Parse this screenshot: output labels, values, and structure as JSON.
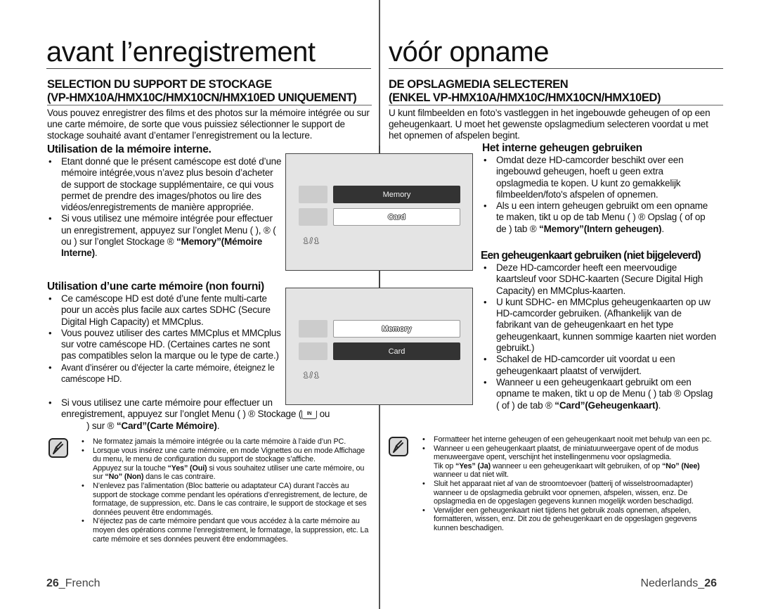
{
  "left": {
    "page_title": "avant l’enregistrement",
    "section_heading_line1": "SELECTION DU SUPPORT DE STOCKAGE",
    "section_heading_line2": "(VP-HMX10A/HMX10C/HMX10CN/HMX10ED UNIQUEMENT)",
    "intro": "Vous pouvez enregistrer des films et des photos sur la mémoire intégrée ou sur une carte mémoire, de sorte que vous puissiez sélectionner le support de stockage souhaité avant d’entamer l’enregistrement ou la lecture.",
    "sub1_heading": "Utilisation de la mémoire interne.",
    "sub1_items": [
      "Etant donné que le présent caméscope est doté d’une mémoire intégrée,vous n’avez plus besoin d’acheter de support de stockage supplémentaire, ce qui vous permet de prendre des images/photos ou lire des vidéos/enregistrements de manière appropriée.",
      "Si vous utilisez une mémoire intégrée pour effectuer un enregistrement, appuyez sur l’onglet Menu (      ), ® (      ou      ) sur l’onglet Stockage ® "
    ],
    "sub1_item2_bold": "“Memory”(Mémoire Interne)",
    "sub2_heading": "Utilisation d’une carte mémoire (non fourni)",
    "sub2_items": [
      "Ce caméscope HD est doté d’une fente multi-carte pour un accès plus facile aux cartes SDHC (Secure Digital High Capacity) et MMCplus.",
      "Vous pouvez utiliser des cartes MMCplus et MMCplus sur votre caméscope HD. (Certaines cartes ne sont pas compatibles selon la marque ou le type de carte.)",
      "Avant d’insérer ou d’éjecter la carte mémoire, éteignez le caméscope HD."
    ],
    "sub2_item4_line1": "Si vous utilisez une carte mémoire pour effectuer un",
    "sub2_item4_line2": "enregistrement, appuyez sur l’onglet Menu (       ) ® Stockage (",
    "sub2_item4_icon": "IN",
    "sub2_item4_line2_end": " ou",
    "sub2_item4_line3": ") sur ® ",
    "sub2_item4_bold": "“Card”(Carte Mémoire)",
    "notes": [
      {
        "text": "Ne formatez jamais la mémoire intégrée ou la carte mémoire à l’aide d’un PC."
      },
      {
        "text": "Lorsque vous insérez une carte mémoire, en mode Vignettes ou en mode Affichage du menu, le menu de configuration du support de stockage s’affiche.",
        "extra_pre": "Appuyez sur la touche ",
        "extra_b1": "“Yes” (Oui)",
        "extra_mid": " si vous souhaitez utiliser une carte mémoire, ou sur ",
        "extra_b2": "“No” (Non)",
        "extra_post": " dans le cas contraire."
      },
      {
        "text": "N’enlevez pas l’alimentation (Bloc batterie ou adaptateur CA) durant l’accès au support de stockage comme pendant les opérations d’enregistrement, de lecture, de formatage, de suppression, etc. Dans le cas contraire, le support de stockage et ses données peuvent être endommagés."
      },
      {
        "text": "N’éjectez pas de carte mémoire pendant que vous accédez à la carte mémoire au moyen des opérations comme l’enregistrement, le formatage, la suppression, etc. La carte mémoire et ses données peuvent être endommagées."
      }
    ],
    "footer_number": "26",
    "footer_label": "_French"
  },
  "right": {
    "page_title": "vóór opname",
    "section_heading_line1": "DE OPSLAGMEDIA SELECTEREN",
    "section_heading_line2": "(ENKEL VP-HMX10A/HMX10C/HMX10CN/HMX10ED)",
    "intro": "U kunt filmbeelden en foto’s vastleggen in het ingebouwde geheugen of op een geheugenkaart. U moet het gewenste opslagmedium selecteren voordat u met het opnemen of afspelen begint.",
    "sub1_heading": "Het interne geheugen gebruiken",
    "sub1_items": [
      "Omdat deze HD-camcorder beschikt over een ingebouwd geheugen, hoeft u geen extra opslagmedia te kopen. U kunt zo gemakkelijk filmbeelden/foto's afspelen of opnemen.",
      "Als u een intern geheugen gebruikt om een opname te maken, tikt u op de tab Menu (      ) ® Opslag (       of       op de ) tab ®"
    ],
    "sub1_item2_bold": "“Memory”(Intern geheugen)",
    "sub2_heading": "Een geheugenkaart gebruiken (niet bijgeleverd)",
    "sub2_items": [
      "Deze HD-camcorder heeft een meervoudige kaartsleuf voor SDHC-kaarten (Secure Digital High Capacity) en MMCplus-kaarten.",
      "U kunt SDHC- en MMCplus geheugenkaarten op uw HD-camcorder gebruiken. (Afhankelijk van de fabrikant van de geheugenkaart en het type geheugenkaart, kunnen sommige kaarten niet worden gebruikt.)",
      "Schakel de HD-camcorder uit voordat u een geheugenkaart plaatst of verwijdert.",
      "Wanneer u een geheugenkaart gebruikt om een opname te maken, tikt u op de Menu (      ) tab ® Opslag (       of       ) de tab ® "
    ],
    "sub2_item4_bold": "“Card”(Geheugenkaart)",
    "notes": [
      {
        "text": "Formatteer het interne geheugen of een geheugenkaart nooit met behulp van een pc."
      },
      {
        "text": "Wanneer u een geheugenkaart plaatst, de miniatuurweergave opent of de modus menuweergave opent, verschijnt het instellingenmenu voor opslagmedia.",
        "extra_pre": "Tik op ",
        "extra_b1": "“Yes” (Ja)",
        "extra_mid": " wanneer u een geheugenkaart wilt gebruiken, of op ",
        "extra_b2": "“No” (Nee)",
        "extra_post": " wanneer u dat niet wilt."
      },
      {
        "text": "Sluit het apparaat niet af van de stroomtoevoer (batterij of wisselstroomadapter) wanneer u de opslagmedia gebruikt voor opnemen, afspelen, wissen, enz. De opslagmedia en de opgeslagen gegevens kunnen mogelijk worden beschadigd."
      },
      {
        "text": "Verwijder een geheugenkaart niet tijdens het gebruik zoals opnemen, afspelen, formatteren, wissen, enz. Dit zou de geheugenkaart en de opgeslagen gegevens kunnen beschadigen."
      }
    ],
    "footer_label": "Nederlands_",
    "footer_number": "26"
  },
  "screens": [
    {
      "options": [
        {
          "label": "Memory",
          "selected": true
        },
        {
          "label": "Card",
          "selected": false
        }
      ],
      "pager": "1 / 1"
    },
    {
      "options": [
        {
          "label": "Memory",
          "selected": false
        },
        {
          "label": "Card",
          "selected": true
        }
      ],
      "pager": "1 / 1"
    }
  ],
  "icons": {
    "note": "note-pencil-icon",
    "storage": "storage-in-icon"
  }
}
